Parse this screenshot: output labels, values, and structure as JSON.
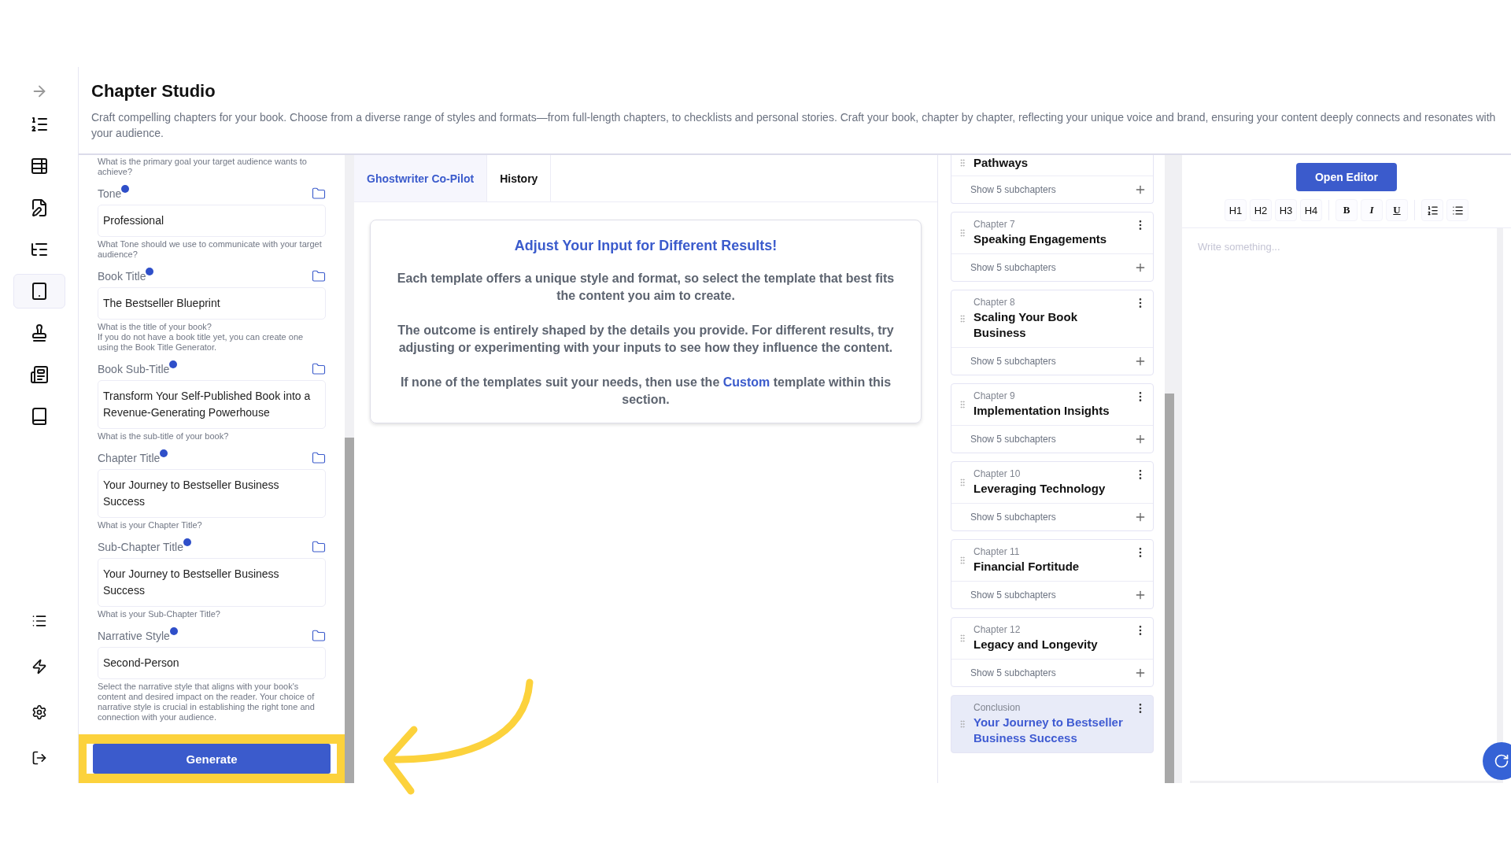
{
  "header": {
    "title": "Chapter Studio",
    "description": "Craft compelling chapters for your book. Choose from a diverse range of styles and formats—from full-length chapters, to checklists and personal stories. Craft your book, chapter by chapter, reflecting your unique voice and brand, ensuring your content deeply connects and resonates with your audience."
  },
  "sidebar": {
    "items": [
      {
        "selected": false
      },
      {
        "selected": false
      },
      {
        "selected": false
      },
      {
        "selected": false
      },
      {
        "selected": true
      },
      {
        "selected": false
      },
      {
        "selected": false
      },
      {
        "selected": false
      }
    ]
  },
  "form": {
    "top_help": "What is the primary goal your target audience wants to achieve?",
    "fields": [
      {
        "label": "Tone",
        "value": "Professional",
        "help": [
          "What Tone should we use to communicate with your target audience?"
        ]
      },
      {
        "label": "Book Title",
        "value": "The Bestseller Blueprint",
        "help": [
          "What is the title of your book?",
          "If you do not have a book title yet, you can create one using the Book Title Generator."
        ]
      },
      {
        "label": "Book Sub-Title",
        "value": "Transform Your Self-Published Book into a Revenue-Generating Powerhouse",
        "help": [
          "What is the sub-title of your book?"
        ]
      },
      {
        "label": "Chapter Title",
        "value": "Your Journey to Bestseller Business Success",
        "help": [
          "What is your Chapter Title?"
        ]
      },
      {
        "label": "Sub-Chapter Title",
        "value": "Your Journey to Bestseller Business Success",
        "help": [
          "What is your Sub-Chapter Title?"
        ]
      },
      {
        "label": "Narrative Style",
        "value": "Second-Person",
        "help": [
          "Select the narrative style that aligns with your book's content and desired impact on the reader. Your choice of narrative style is crucial in establishing the right tone and connection with your audience."
        ]
      }
    ],
    "generate_button": "Generate"
  },
  "tabs": [
    {
      "label": "Ghostwriter Co-Pilot",
      "selected": true
    },
    {
      "label": "History",
      "selected": false
    }
  ],
  "info_card": {
    "title": "Adjust Your Input for Different Results!",
    "paragraphs": [
      "Each template offers a unique style and format, so select the template that best fits the content you aim to create.",
      "The outcome is entirely shaped by the details you provide. For different results, try adjusting or experimenting with your inputs to see how they influence the content.",
      "If none of the templates suit your needs, then use the **Custom** template within this section."
    ]
  },
  "chapters": [
    {
      "title": "Pathways",
      "subchapters": "Show 5 subchapters",
      "selected": false
    },
    {
      "label": "Chapter 7",
      "title": "Speaking Engagements",
      "subchapters": "Show 5 subchapters",
      "selected": false
    },
    {
      "label": "Chapter 8",
      "title": "Scaling Your Book Business",
      "subchapters": "Show 5 subchapters",
      "selected": false
    },
    {
      "label": "Chapter 9",
      "title": "Implementation Insights",
      "subchapters": "Show 5 subchapters",
      "selected": false
    },
    {
      "label": "Chapter 10",
      "title": "Leveraging Technology",
      "subchapters": "Show 5 subchapters",
      "selected": false
    },
    {
      "label": "Chapter 11",
      "title": "Financial Fortitude",
      "subchapters": "Show 5 subchapters",
      "selected": false
    },
    {
      "label": "Chapter 12",
      "title": "Legacy and Longevity",
      "subchapters": "Show 5 subchapters",
      "selected": false
    },
    {
      "label": "Conclusion",
      "title": "Your Journey to Bestseller Business Success",
      "selected": true
    }
  ],
  "editor": {
    "open_button": "Open Editor",
    "toolbar": [
      [
        {
          "kind": "text",
          "label": "H1"
        },
        {
          "kind": "text",
          "label": "H2"
        },
        {
          "kind": "text",
          "label": "H3"
        },
        {
          "kind": "text",
          "label": "H4"
        }
      ],
      [
        {
          "kind": "bold",
          "label": "B"
        },
        {
          "kind": "italic",
          "label": "I"
        },
        {
          "kind": "underline",
          "label": "U"
        }
      ],
      [
        {
          "kind": "ordered-list"
        },
        {
          "kind": "bullet-list"
        }
      ]
    ],
    "placeholder": "Write something..."
  },
  "tutorial_overlay": {
    "highlight_generate": true,
    "arrow": true
  }
}
